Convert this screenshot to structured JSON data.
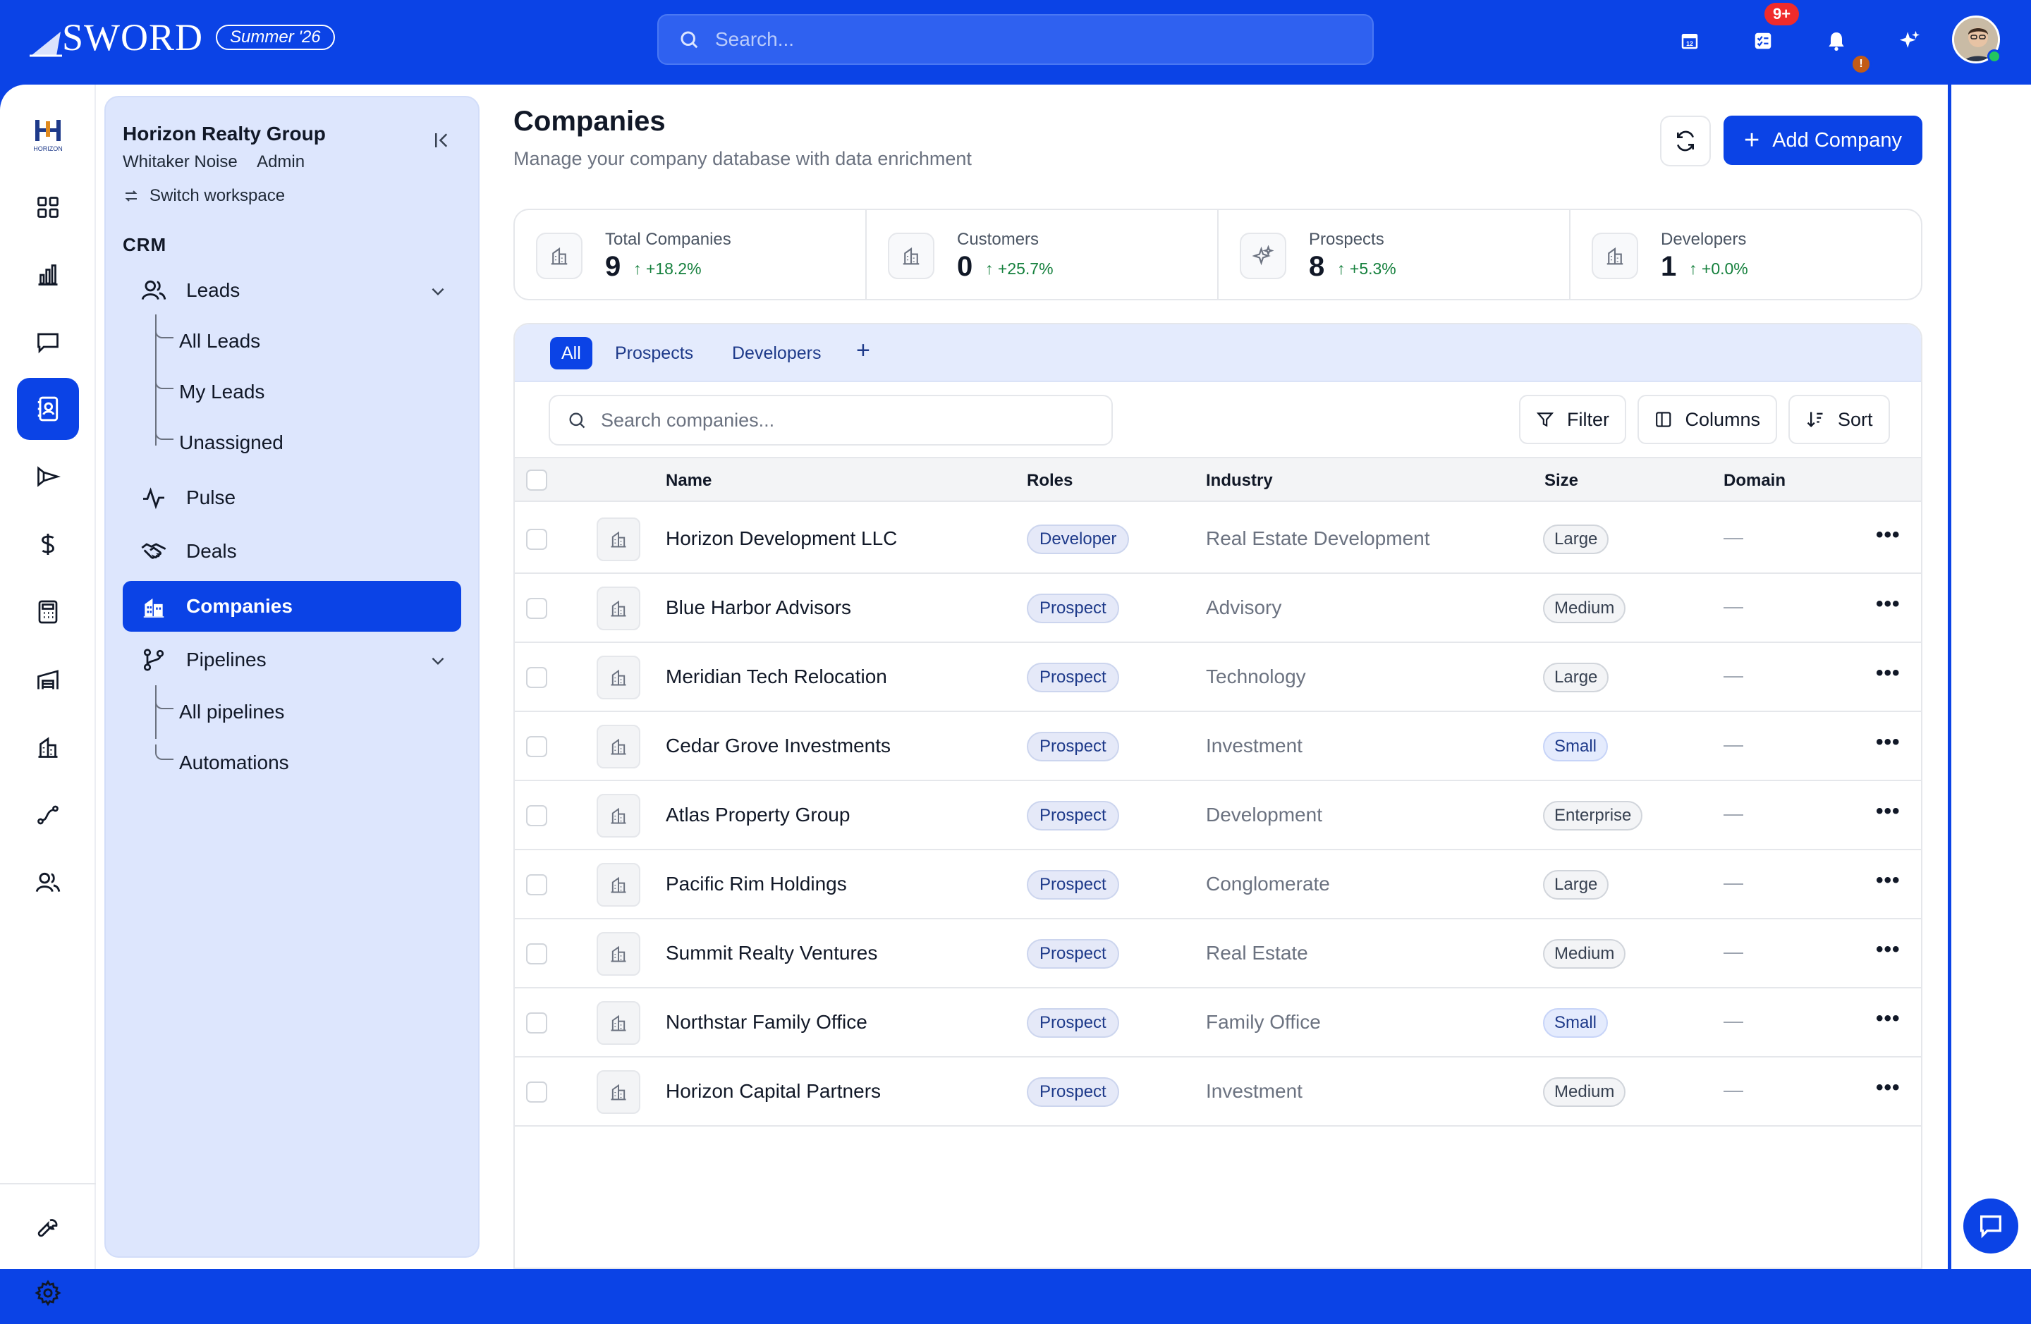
{
  "brand": {
    "name": "SWORD",
    "edition": "Summer '26"
  },
  "topbar": {
    "search_placeholder": "Search...",
    "tasks_badge": "9+",
    "alert_badge": "!"
  },
  "workspace": {
    "name": "Horizon Realty Group",
    "user": "Whitaker Noise",
    "role": "Admin",
    "switch_label": "Switch workspace",
    "logo_text": "HORIZON"
  },
  "sidebar": {
    "section": "CRM",
    "leads": {
      "label": "Leads",
      "children": [
        "All Leads",
        "My Leads",
        "Unassigned"
      ]
    },
    "pulse": "Pulse",
    "deals": "Deals",
    "companies": "Companies",
    "pipelines": {
      "label": "Pipelines",
      "children": [
        "All pipelines",
        "Automations"
      ]
    }
  },
  "header": {
    "title": "Companies",
    "subtitle": "Manage your company database with data enrichment",
    "add_button": "Add Company"
  },
  "stats": [
    {
      "label": "Total Companies",
      "value": "9",
      "change": "+18.2%",
      "icon": "building-icon"
    },
    {
      "label": "Customers",
      "value": "0",
      "change": "+25.7%",
      "icon": "building-icon"
    },
    {
      "label": "Prospects",
      "value": "8",
      "change": "+5.3%",
      "icon": "sparkles-icon"
    },
    {
      "label": "Developers",
      "value": "1",
      "change": "+0.0%",
      "icon": "building-icon"
    }
  ],
  "tabs": [
    "All",
    "Prospects",
    "Developers"
  ],
  "table": {
    "search_placeholder": "Search companies...",
    "filter_label": "Filter",
    "columns_label": "Columns",
    "sort_label": "Sort",
    "headers": {
      "name": "Name",
      "roles": "Roles",
      "industry": "Industry",
      "size": "Size",
      "domain": "Domain"
    },
    "rows": [
      {
        "name": "Horizon Development LLC",
        "role": "Developer",
        "industry": "Real Estate Development",
        "size": "Large",
        "domain": "—"
      },
      {
        "name": "Blue Harbor Advisors",
        "role": "Prospect",
        "industry": "Advisory",
        "size": "Medium",
        "domain": "—"
      },
      {
        "name": "Meridian Tech Relocation",
        "role": "Prospect",
        "industry": "Technology",
        "size": "Large",
        "domain": "—"
      },
      {
        "name": "Cedar Grove Investments",
        "role": "Prospect",
        "industry": "Investment",
        "size": "Small",
        "domain": "—"
      },
      {
        "name": "Atlas Property Group",
        "role": "Prospect",
        "industry": "Development",
        "size": "Enterprise",
        "domain": "—"
      },
      {
        "name": "Pacific Rim Holdings",
        "role": "Prospect",
        "industry": "Conglomerate",
        "size": "Large",
        "domain": "—"
      },
      {
        "name": "Summit Realty Ventures",
        "role": "Prospect",
        "industry": "Real Estate",
        "size": "Medium",
        "domain": "—"
      },
      {
        "name": "Northstar Family Office",
        "role": "Prospect",
        "industry": "Family Office",
        "size": "Small",
        "domain": "—"
      },
      {
        "name": "Horizon Capital Partners",
        "role": "Prospect",
        "industry": "Investment",
        "size": "Medium",
        "domain": "—"
      }
    ]
  },
  "colors": {
    "brand_blue": "#0b43e6",
    "positive": "#15803d",
    "sidebar_bg": "#dde6fd"
  }
}
